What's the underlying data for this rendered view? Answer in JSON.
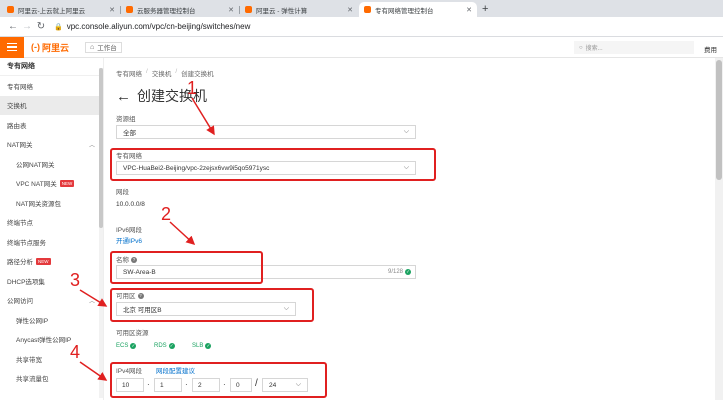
{
  "browser": {
    "tabs": [
      {
        "title": "阿里云-上云就上阿里云",
        "active": false
      },
      {
        "title": "云服务器管理控制台",
        "active": false
      },
      {
        "title": "阿里云 - 弹性计算",
        "active": false
      },
      {
        "title": "专有网络管理控制台",
        "active": true
      }
    ],
    "new_tab": "+",
    "url": "vpc.console.aliyun.com/vpc/cn-beijing/switches/new"
  },
  "header": {
    "logo_mark": "(-)",
    "logo_text": "阿里云",
    "workbench": "工作台",
    "search_placeholder": "搜索...",
    "right_text": "费用"
  },
  "sidebar": {
    "title": "专有网络",
    "items": [
      {
        "label": "专有网络",
        "level": 0
      },
      {
        "label": "交换机",
        "level": 0,
        "active": true
      },
      {
        "label": "路由表",
        "level": 0
      },
      {
        "label": "NAT网关",
        "level": 0,
        "expanded": true
      },
      {
        "label": "公网NAT网关",
        "level": 1
      },
      {
        "label": "VPC NAT网关",
        "level": 1,
        "badge": "NEW"
      },
      {
        "label": "NAT网关资源包",
        "level": 1
      },
      {
        "label": "终端节点",
        "level": 0
      },
      {
        "label": "终端节点服务",
        "level": 0
      },
      {
        "label": "路径分析",
        "level": 0,
        "badge": "NEW"
      },
      {
        "label": "DHCP选项集",
        "level": 0
      },
      {
        "label": "公网访问",
        "level": 0,
        "expanded": true
      },
      {
        "label": "弹性公网IP",
        "level": 1
      },
      {
        "label": "Anycast弹性公网IP",
        "level": 1
      },
      {
        "label": "共享带宽",
        "level": 1
      },
      {
        "label": "共享流量包",
        "level": 1
      }
    ]
  },
  "main": {
    "breadcrumb": [
      "专有网络",
      "交换机",
      "创建交换机"
    ],
    "breadcrumb_sep": "/",
    "title": "创建交换机",
    "resource_group_label": "资源组",
    "resource_group_value": "全部",
    "vpc_label": "专有网络",
    "vpc_value": "VPC-HuaBei2-Beijing/vpc-2zejsx6vw9i5qo5971ysc",
    "network_label": "网段",
    "network_value": "10.0.0.0/8",
    "ipv6_label": "IPv6网段",
    "ipv6_link": "开通IPv6",
    "name_label": "名称",
    "name_value": "SW-Area-B",
    "name_count": "9/128",
    "zone_label": "可用区",
    "zone_value": "北京 可用区B",
    "zone_resources_label": "可用区资源",
    "zone_resources": [
      "ECS",
      "RDS",
      "SLB"
    ],
    "ipv4_label": "IPv4网段",
    "ipv4_link": "网段配置建议",
    "ipv4_octets": [
      "10",
      "1",
      "2",
      "0"
    ],
    "ipv4_mask": "24"
  },
  "annotations": {
    "numbers": [
      "1",
      "2",
      "3",
      "4"
    ],
    "color": "#e02020"
  }
}
